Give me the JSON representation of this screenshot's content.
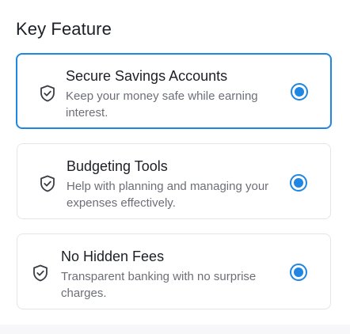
{
  "section": {
    "title": "Key Feature"
  },
  "features": [
    {
      "title": "Secure Savings Accounts",
      "description": "Keep your money safe while earning interest.",
      "icon": "shield-check-icon",
      "selected": true
    },
    {
      "title": "Budgeting Tools",
      "description": "Help with planning and managing your expenses effectively.",
      "icon": "shield-check-icon",
      "selected": true
    },
    {
      "title": "No Hidden Fees",
      "description": "Transparent banking with no surprise charges.",
      "icon": "shield-check-icon",
      "selected": true
    }
  ],
  "colors": {
    "accent": "#1f86e3",
    "border": "#e4e5ea",
    "title_text": "#1d1f27",
    "secondary_text": "#6d6f78"
  }
}
